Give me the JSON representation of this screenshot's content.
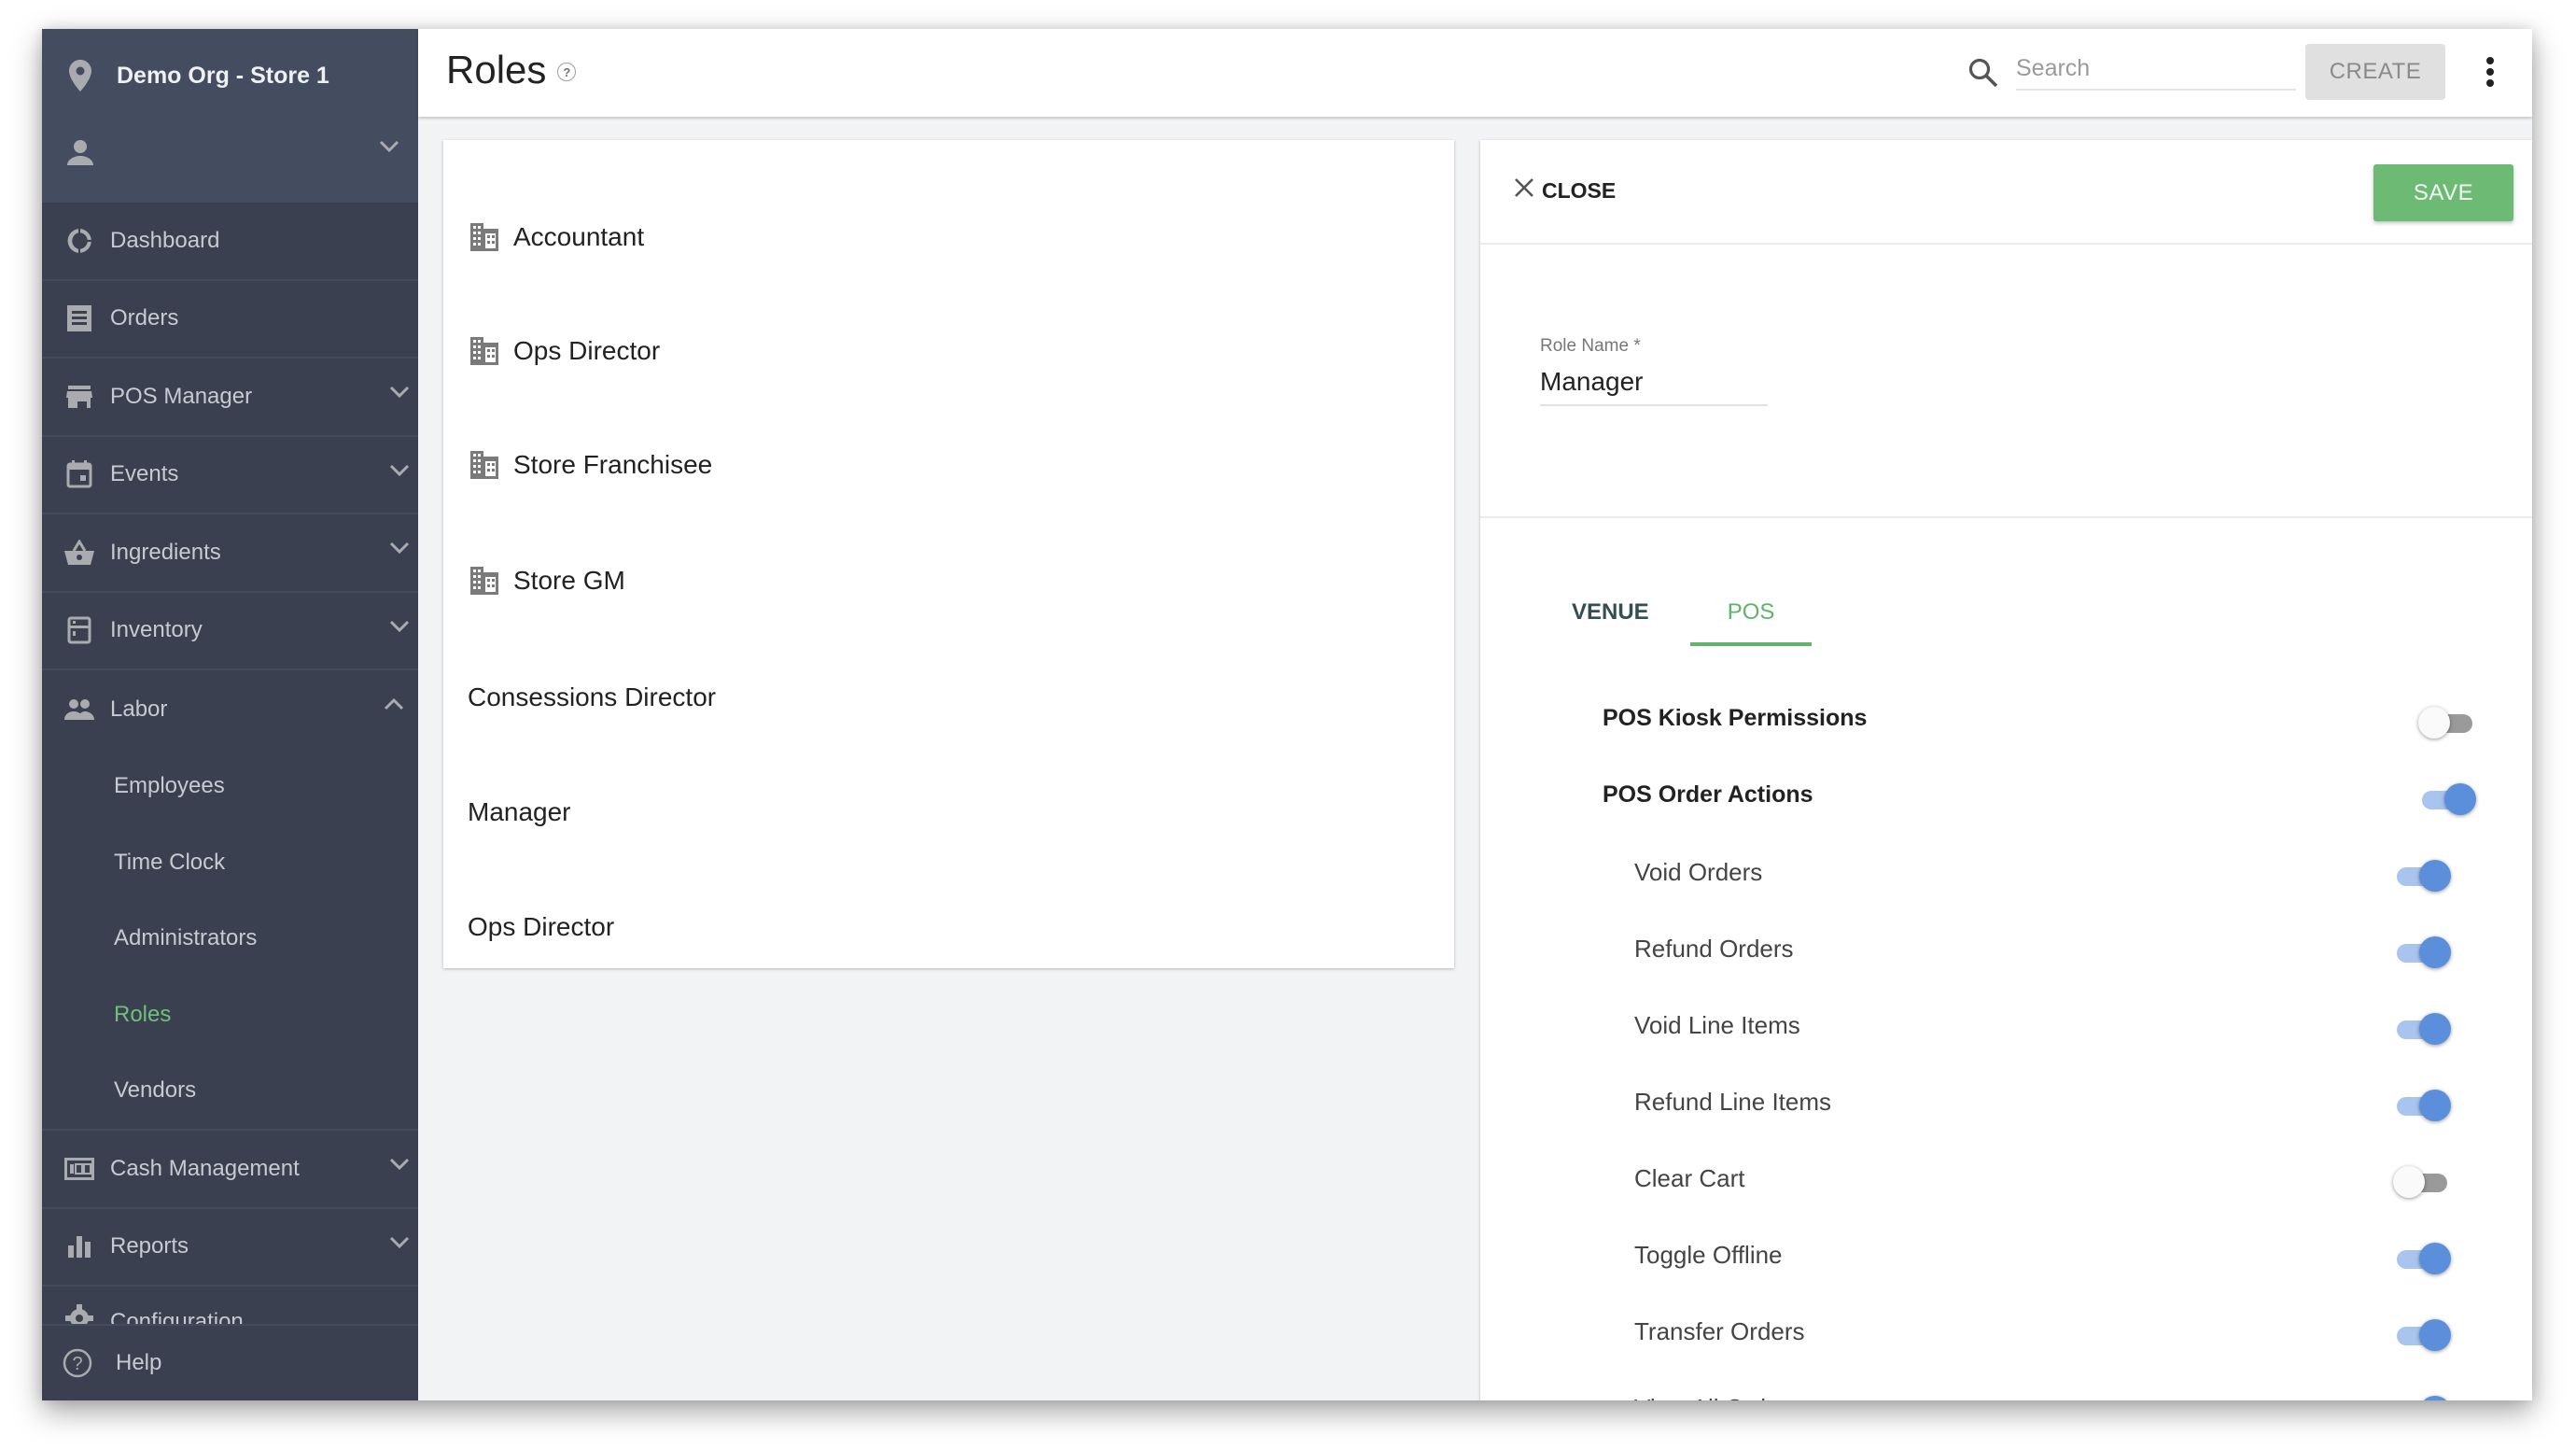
{
  "sidebar": {
    "org_name": "Demo Org - Store 1",
    "items": [
      {
        "label": "Dashboard",
        "icon": "dashboard-icon",
        "expandable": false
      },
      {
        "label": "Orders",
        "icon": "receipt-icon",
        "expandable": false
      },
      {
        "label": "POS Manager",
        "icon": "store-icon",
        "expandable": true
      },
      {
        "label": "Events",
        "icon": "calendar-icon",
        "expandable": true
      },
      {
        "label": "Ingredients",
        "icon": "basket-icon",
        "expandable": true
      },
      {
        "label": "Inventory",
        "icon": "inventory-icon",
        "expandable": true
      },
      {
        "label": "Labor",
        "icon": "people-icon",
        "expandable": true,
        "expanded": true,
        "children": [
          "Employees",
          "Time Clock",
          "Administrators",
          "Roles",
          "Vendors"
        ],
        "active_child": "Roles"
      },
      {
        "label": "Cash Management",
        "icon": "cash-icon",
        "expandable": true
      },
      {
        "label": "Reports",
        "icon": "bar-chart-icon",
        "expandable": true
      },
      {
        "label": "Configuration",
        "icon": "gear-icon",
        "expandable": true
      }
    ],
    "help_label": "Help"
  },
  "header": {
    "title": "Roles",
    "search_placeholder": "Search",
    "search_value": "",
    "create_label": "CREATE"
  },
  "roles": [
    {
      "name": "Accountant",
      "icon": "building-icon"
    },
    {
      "name": "Ops Director",
      "icon": "building-icon"
    },
    {
      "name": "Store Franchisee",
      "icon": "building-icon"
    },
    {
      "name": "Store GM",
      "icon": "building-icon"
    },
    {
      "name": "Consessions Director",
      "icon": null
    },
    {
      "name": "Manager",
      "icon": null
    },
    {
      "name": "Ops Director",
      "icon": null
    }
  ],
  "detail": {
    "close_label": "CLOSE",
    "save_label": "SAVE",
    "role_name_label": "Role Name *",
    "role_name_value": "Manager",
    "tabs": [
      {
        "label": "VENUE",
        "active": false
      },
      {
        "label": "POS",
        "active": true
      }
    ],
    "permissions": [
      {
        "label": "POS Kiosk Permissions",
        "level": "parent",
        "enabled": false
      },
      {
        "label": "POS Order Actions",
        "level": "parent",
        "enabled": true
      },
      {
        "label": "Void Orders",
        "level": "child",
        "enabled": true
      },
      {
        "label": "Refund Orders",
        "level": "child",
        "enabled": true
      },
      {
        "label": "Void Line Items",
        "level": "child",
        "enabled": true
      },
      {
        "label": "Refund Line Items",
        "level": "child",
        "enabled": true
      },
      {
        "label": "Clear Cart",
        "level": "child",
        "enabled": false
      },
      {
        "label": "Toggle Offline",
        "level": "child",
        "enabled": true
      },
      {
        "label": "Transfer Orders",
        "level": "child",
        "enabled": true
      },
      {
        "label": "View All Orders",
        "level": "child",
        "enabled": true
      }
    ]
  },
  "colors": {
    "accent_green": "#5fb36a",
    "toggle_on": "#5b8fdb",
    "sidebar_bg": "#3a4050"
  }
}
